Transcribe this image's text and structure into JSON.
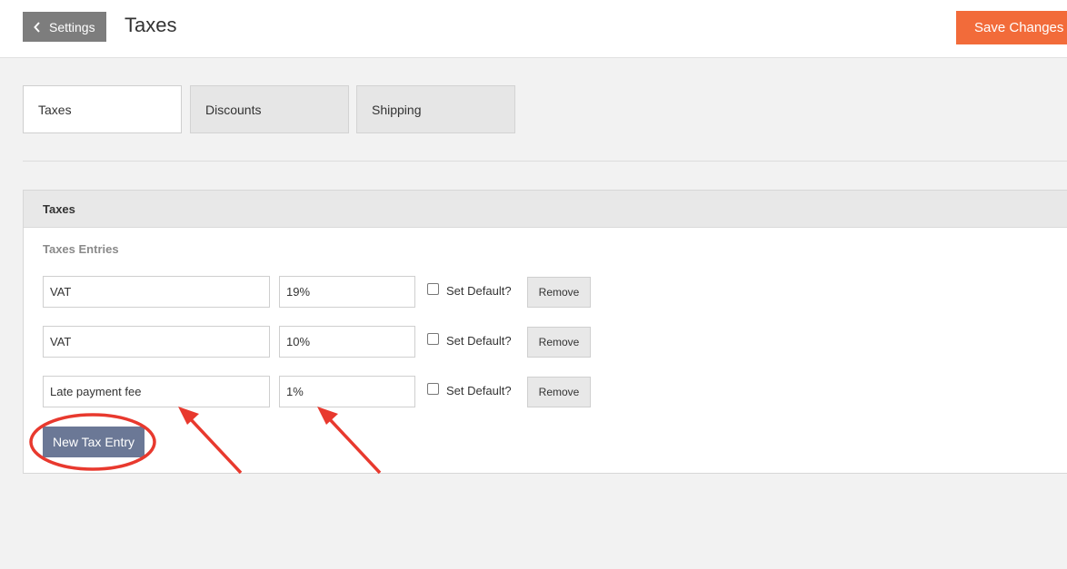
{
  "header": {
    "back_label": "Settings",
    "title": "Taxes",
    "save_label": "Save Changes"
  },
  "tabs": [
    {
      "label": "Taxes",
      "active": true
    },
    {
      "label": "Discounts",
      "active": false
    },
    {
      "label": "Shipping",
      "active": false
    }
  ],
  "panel": {
    "title": "Taxes",
    "section_label": "Taxes Entries",
    "entries": [
      {
        "name": "VAT",
        "rate": "19%",
        "default_label": "Set Default?",
        "default_checked": false,
        "remove_label": "Remove"
      },
      {
        "name": "VAT",
        "rate": "10%",
        "default_label": "Set Default?",
        "default_checked": false,
        "remove_label": "Remove"
      },
      {
        "name": "Late payment fee",
        "rate": "1%",
        "default_label": "Set Default?",
        "default_checked": false,
        "remove_label": "Remove"
      }
    ],
    "new_entry_label": "New Tax Entry"
  },
  "colors": {
    "accent": "#f26b3a",
    "back_button": "#7d7d7d",
    "new_entry_button": "#6b7896",
    "annotation": "#e8392e"
  },
  "icons": {
    "back": "chevron-left-icon"
  }
}
